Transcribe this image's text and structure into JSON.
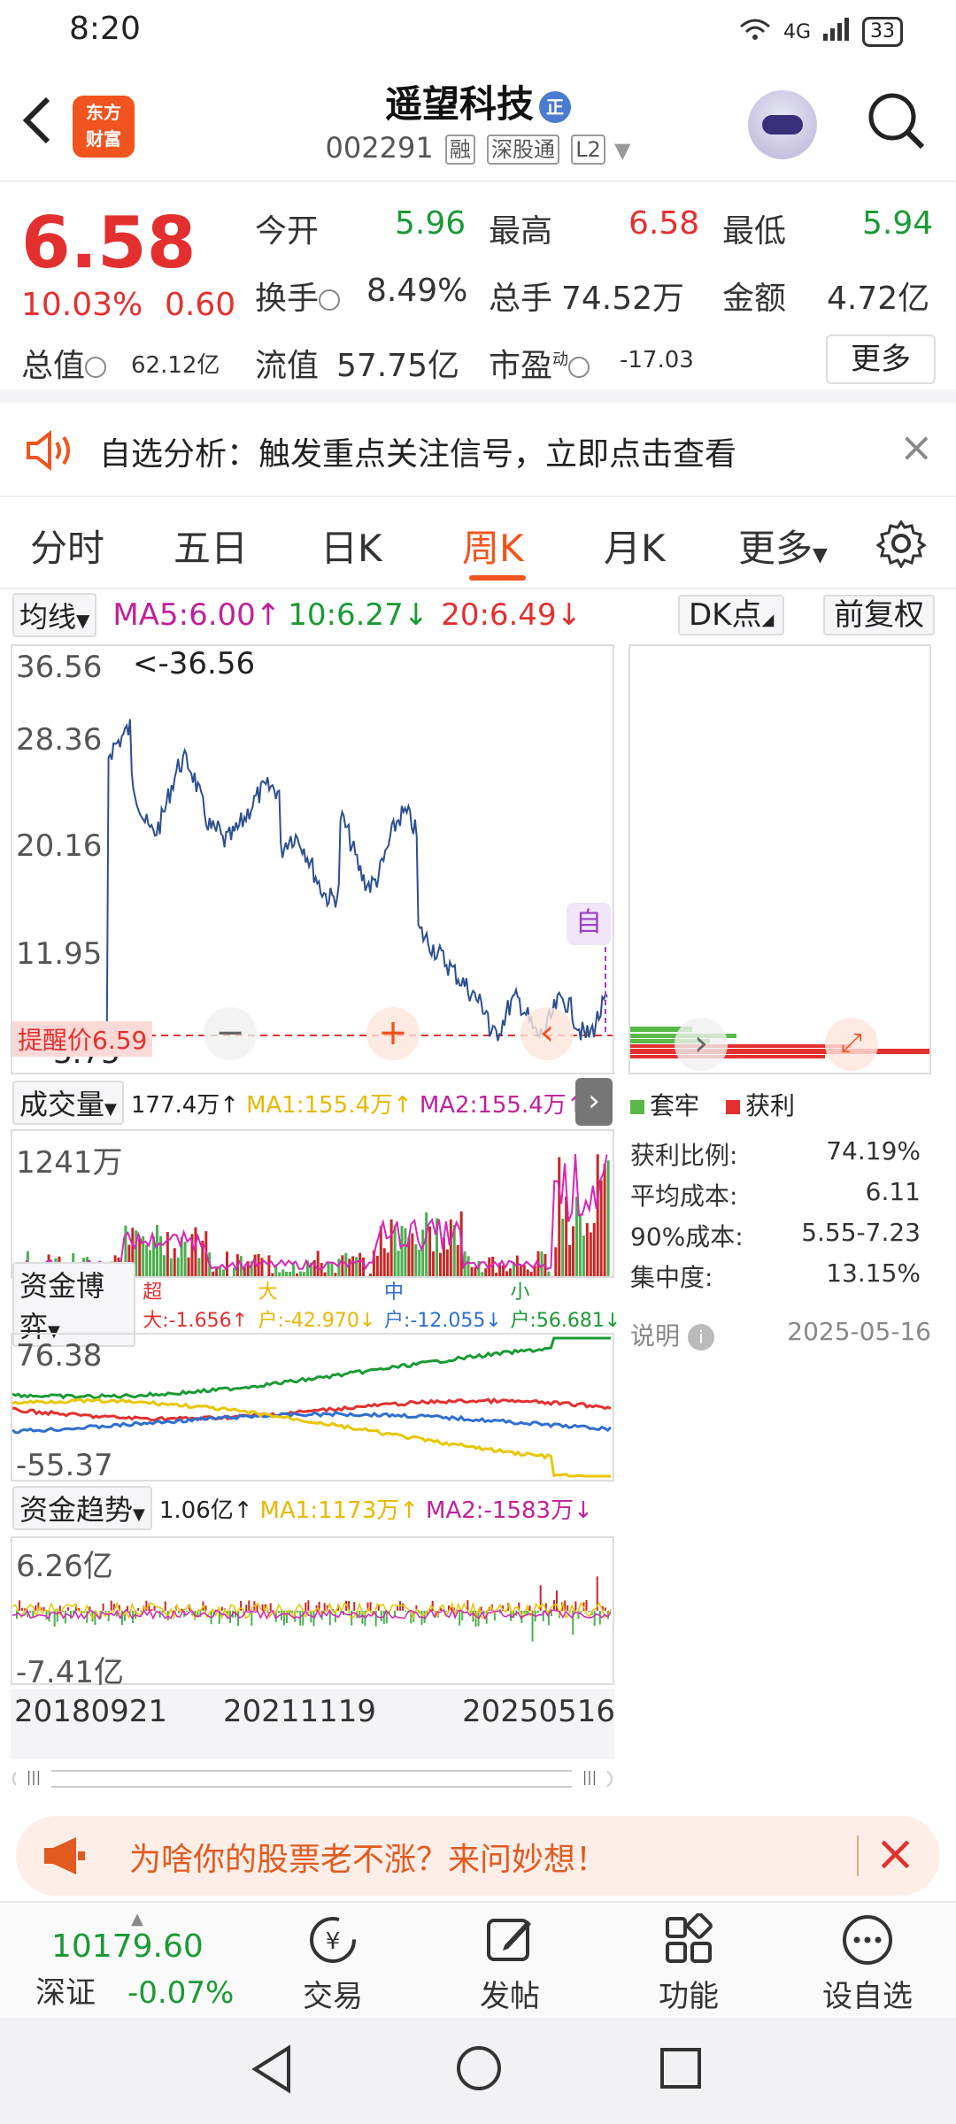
{
  "status": {
    "time": "8:20",
    "network": "4G",
    "battery": "33"
  },
  "header": {
    "logo_line1": "东方",
    "logo_line2": "财富",
    "stock_name": "遥望科技",
    "name_badge": "正",
    "stock_code": "002291",
    "tags": [
      "融",
      "深股通",
      "L2"
    ]
  },
  "quote": {
    "price": "6.58",
    "change_pct": "10.03%",
    "change": "0.60",
    "open_label": "今开",
    "open": "5.96",
    "high_label": "最高",
    "high": "6.58",
    "low_label": "最低",
    "low": "5.94",
    "turnover_label": "换手",
    "turnover": "8.49%",
    "volume_label": "总手",
    "volume": "74.52万",
    "amount_label": "金额",
    "amount": "4.72亿",
    "mktcap_label": "总值",
    "mktcap": "62.12亿",
    "float_label": "流值",
    "float": "57.75亿",
    "pe_label": "市盈",
    "pe_sup": "动",
    "pe": "-17.03",
    "more_label": "更多"
  },
  "alert": {
    "text": "自选分析：触发重点关注信号，立即点击查看"
  },
  "tabs": [
    {
      "label": "分时"
    },
    {
      "label": "五日"
    },
    {
      "label": "日K"
    },
    {
      "label": "周K",
      "active": true
    },
    {
      "label": "月K"
    },
    {
      "label": "更多"
    }
  ],
  "ma": {
    "dropdown": "均线",
    "ma5": "MA5:6.00↑",
    "ma10": "10:6.27↓",
    "ma20": "20:6.49↓",
    "dk_label": "DK点",
    "adjust_label": "前复权"
  },
  "kline": {
    "y_labels": [
      "36.56",
      "28.36",
      "20.16",
      "11.95",
      "3.75"
    ],
    "max_note": "<-36.56",
    "remind_label": "提醒价6.59",
    "auto_label": "自"
  },
  "volume": {
    "dropdown": "成交量",
    "value": "177.4万↑",
    "ma1": "MA1:155.4万↑",
    "ma2": "MA2:155.4万↑",
    "y_top": "1241万"
  },
  "capital_game": {
    "dropdown": "资金博弈",
    "super": "超大:-1.656↑",
    "large": "大户:-42.970↓",
    "mid": "中户:-12.055↓",
    "small": "小户:56.681↓",
    "y_top": "76.38",
    "y_bottom": "-55.37"
  },
  "capital_trend": {
    "dropdown": "资金趋势",
    "value": "1.06亿↑",
    "ma1": "MA1:1173万↑",
    "ma2": "MA2:-1583万↓",
    "y_top": "6.26亿",
    "y_bottom": "-7.41亿"
  },
  "dates": [
    "20180921",
    "20211119",
    "20250516"
  ],
  "chips": {
    "legend_trapped": "套牢",
    "legend_profit": "获利",
    "stats": [
      {
        "label": "获利比例:",
        "value": "74.19%"
      },
      {
        "label": "平均成本:",
        "value": "6.11"
      },
      {
        "label": "90%成本:",
        "value": "5.55-7.23"
      },
      {
        "label": "集中度:",
        "value": "13.15%"
      }
    ],
    "note_label": "说明",
    "date": "2025-05-16"
  },
  "promo": {
    "text": "为啥你的股票老不涨？来问妙想！"
  },
  "bottomnav": {
    "index_value": "10179.60",
    "index_name": "深证",
    "index_change": "-0.07%",
    "items": [
      {
        "label": "交易"
      },
      {
        "label": "发帖"
      },
      {
        "label": "功能"
      },
      {
        "label": "设自选"
      }
    ]
  },
  "colors": {
    "accent": "#f1541e",
    "up": "#e3302f",
    "down": "#1a9a35"
  }
}
